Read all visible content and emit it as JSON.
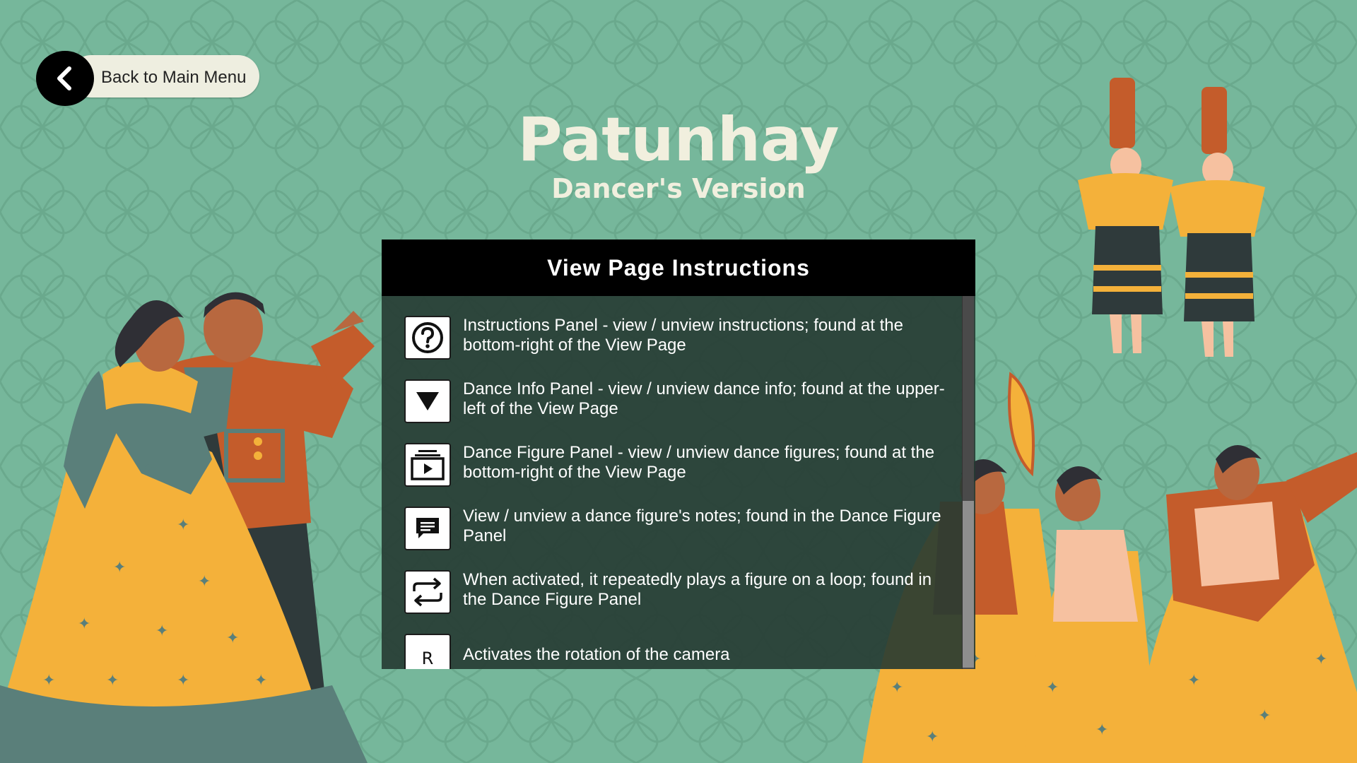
{
  "back_button": {
    "label": "Back to Main Menu"
  },
  "header": {
    "title": "Patunhay",
    "subtitle": "Dancer's Version"
  },
  "instructions_panel": {
    "title": "View Page Instructions",
    "items": [
      {
        "icon": "question-circle-icon",
        "text": "Instructions Panel - view / unview instructions; found at the bottom-right of the View Page"
      },
      {
        "icon": "triangle-down-icon",
        "text": "Dance Info Panel - view / unview dance info; found at the upper-left of the View Page"
      },
      {
        "icon": "video-stack-icon",
        "text": "Dance Figure Panel - view / unview dance figures; found at the bottom-right of the View Page"
      },
      {
        "icon": "speech-bubble-icon",
        "text": "View / unview a dance figure's notes; found in the Dance Figure Panel"
      },
      {
        "icon": "repeat-loop-icon",
        "text": "When activated, it repeatedly plays a figure on a loop; found in the Dance Figure Panel"
      },
      {
        "icon": "key-r-icon",
        "key": "R",
        "text": "Activates the rotation of the camera"
      }
    ],
    "scroll_fraction": 0.55
  },
  "colors": {
    "background": "#76b79b",
    "title": "#f1efde",
    "panel_header": "#000000",
    "panel_body": "#263a32",
    "skirt_yellow": "#f4b13a",
    "shirt_orange": "#c45c2b",
    "teal_dress": "#5a7f7a"
  }
}
